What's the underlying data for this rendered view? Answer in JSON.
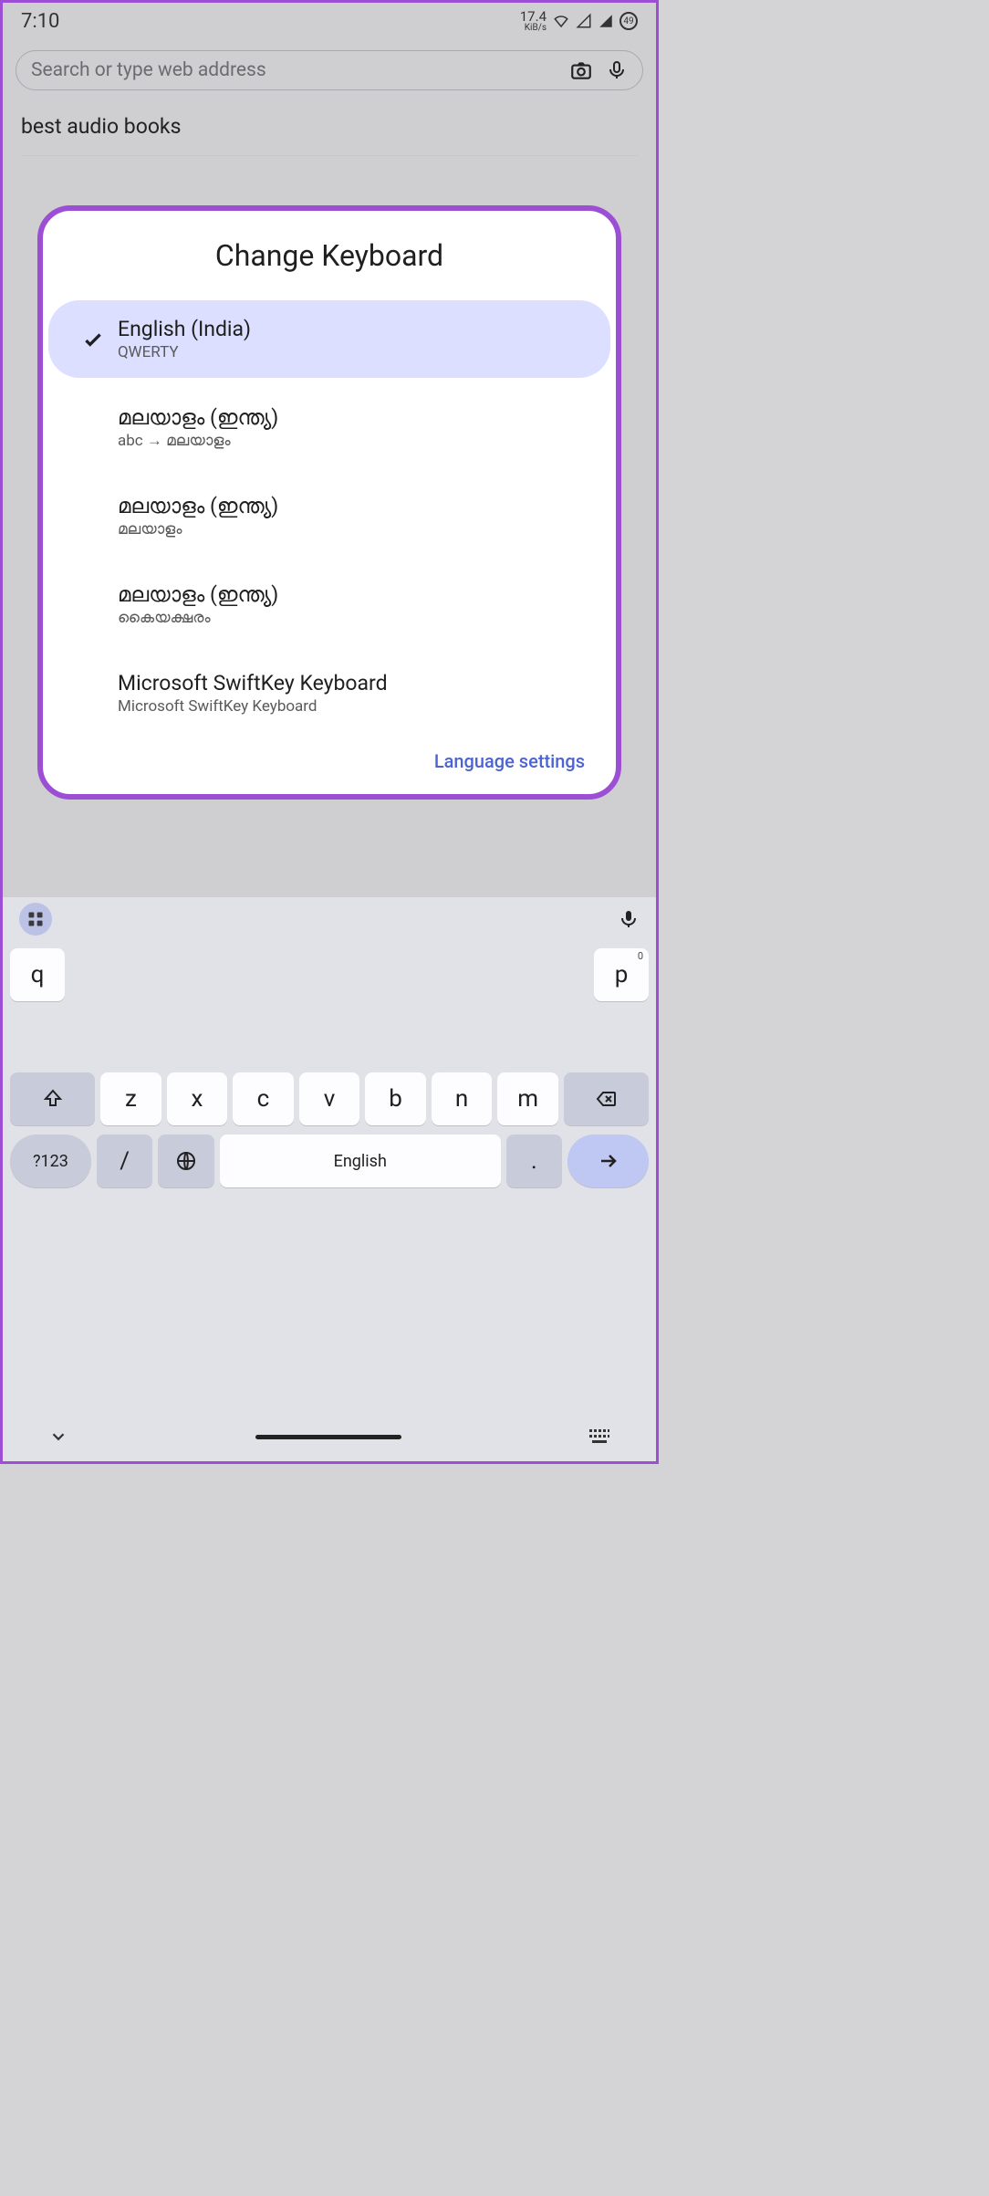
{
  "status": {
    "time": "7:10",
    "speed_value": "17.4",
    "speed_unit": "KiB/s",
    "battery_pct": "49"
  },
  "search": {
    "placeholder": "Search or type web address"
  },
  "suggestion": {
    "text": "best audio books"
  },
  "dialog": {
    "title": "Change Keyboard",
    "items": [
      {
        "name": "English (India)",
        "sub": "QWERTY",
        "selected": true
      },
      {
        "name": "മലയാളം (ഇന്ത്യ)",
        "sub": "abc → മലയാളം",
        "selected": false
      },
      {
        "name": "മലയാളം (ഇന്ത്യ)",
        "sub": "മലയാളം",
        "selected": false
      },
      {
        "name": "മലയാളം (ഇന്ത്യ)",
        "sub": "കൈയക്ഷരം",
        "selected": false
      },
      {
        "name": "Microsoft SwiftKey Keyboard",
        "sub": "Microsoft SwiftKey Keyboard",
        "selected": false
      }
    ],
    "language_settings": "Language settings"
  },
  "keyboard": {
    "space_label": "English",
    "symkey": "?123",
    "slash": "/",
    "period": ".",
    "row1_partial": {
      "q": "q",
      "p": "p",
      "p_alt": "0"
    },
    "row3": [
      "z",
      "x",
      "c",
      "v",
      "b",
      "n",
      "m"
    ]
  }
}
